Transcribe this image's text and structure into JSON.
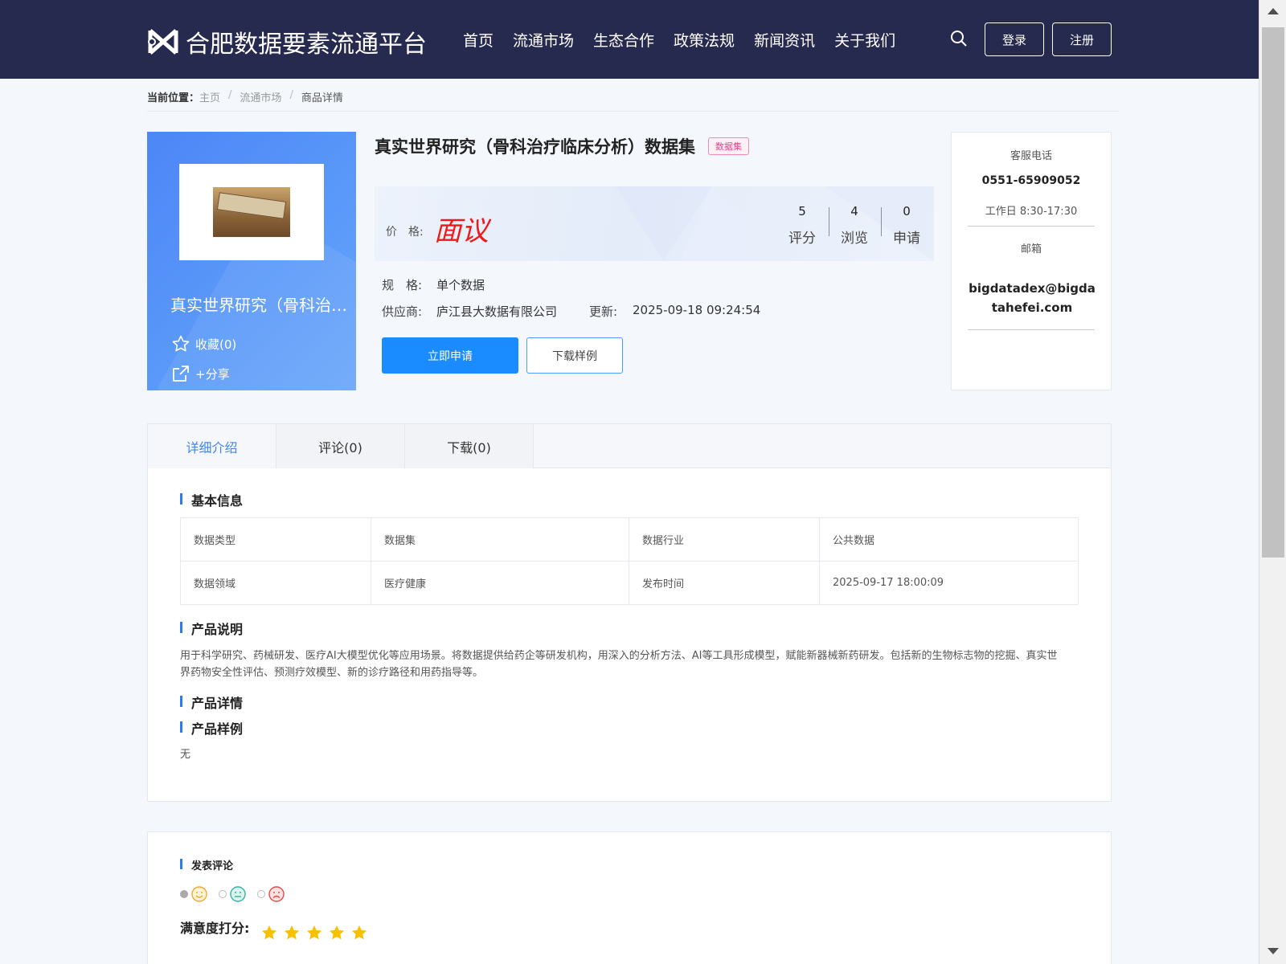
{
  "header": {
    "site_name": "合肥数据要素流通平台",
    "nav": [
      "首页",
      "流通市场",
      "生态合作",
      "政策法规",
      "新闻资讯",
      "关于我们"
    ],
    "login": "登录",
    "register": "注册"
  },
  "breadcrumb": {
    "label": "当前位置：",
    "items": [
      "主页",
      "流通市场",
      "商品详情"
    ]
  },
  "product": {
    "card_name": "真实世界研究（骨科治疗临床分析）数据集",
    "favorite": "收藏(0)",
    "share": "+分享",
    "title": "真实世界研究（骨科治疗临床分析）数据集",
    "tag": "数据集",
    "price_label": "价　格:",
    "price_value": "面议",
    "stats": [
      {
        "num": "5",
        "label": "评分"
      },
      {
        "num": "4",
        "label": "浏览"
      },
      {
        "num": "0",
        "label": "申请"
      }
    ],
    "spec_key": "规　格:",
    "spec_val": "单个数据",
    "supplier_key": "供应商:",
    "supplier_val": "庐江县大数据有限公司",
    "update_key": "更新:",
    "update_val": "2025-09-18 09:24:54",
    "apply_btn": "立即申请",
    "sample_btn": "下载样例"
  },
  "contact": {
    "phone_label": "客服电话",
    "phone": "0551-65909052",
    "hours": "工作日 8:30-17:30",
    "email_label": "邮箱",
    "email": "bigdatadex@bigdatahefei.com"
  },
  "tabs": [
    "详细介绍",
    "评论(0)",
    "下载(0)"
  ],
  "details": {
    "basic_title": "基本信息",
    "table": [
      [
        "数据类型",
        "数据集",
        "数据行业",
        "公共数据"
      ],
      [
        "数据领域",
        "医疗健康",
        "发布时间",
        "2025-09-17 18:00:09"
      ]
    ],
    "desc_title": "产品说明",
    "desc_text": "用于科学研究、药械研发、医疗AI大模型优化等应用场景。将数据提供给药企等研发机构，用深入的分析方法、AI等工具形成模型，赋能新器械新药研发。包括新的生物标志物的挖掘、真实世界药物安全性评估、预测疗效模型、新的诊疗路径和用药指导等。",
    "detail_title": "产品详情",
    "sample_title": "产品样例",
    "sample_text": "无"
  },
  "comment": {
    "title": "发表评论",
    "rate_label": "满意度打分:",
    "stars": 5
  },
  "colors": {
    "header_bg": "#272a4f",
    "primary": "#1a8cff",
    "price": "#f01818",
    "star": "#f7c100"
  }
}
